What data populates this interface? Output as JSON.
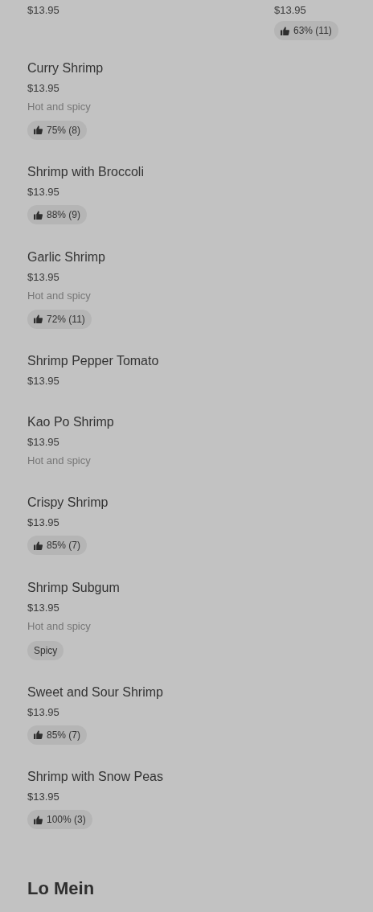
{
  "top_row": [
    {
      "price": "$13.95"
    },
    {
      "price": "$13.95",
      "rating": "63% (11)"
    }
  ],
  "items": [
    {
      "name": "Curry Shrimp",
      "price": "$13.95",
      "description": "Hot and spicy",
      "rating": "75% (8)"
    },
    {
      "name": "Shrimp with Broccoli",
      "price": "$13.95",
      "rating": "88% (9)"
    },
    {
      "name": "Garlic Shrimp",
      "price": "$13.95",
      "description": "Hot and spicy",
      "rating": "72% (11)"
    },
    {
      "name": "Shrimp Pepper Tomato",
      "price": "$13.95"
    },
    {
      "name": "Kao Po Shrimp",
      "price": "$13.95",
      "description": "Hot and spicy"
    },
    {
      "name": "Crispy Shrimp",
      "price": "$13.95",
      "rating": "85% (7)"
    },
    {
      "name": "Shrimp Subgum",
      "price": "$13.95",
      "description": "Hot and spicy",
      "tag": "Spicy"
    },
    {
      "name": "Sweet and Sour Shrimp",
      "price": "$13.95",
      "rating": "85% (7)"
    },
    {
      "name": "Shrimp with Snow Peas",
      "price": "$13.95",
      "rating": "100% (3)"
    }
  ],
  "next_section": {
    "title": "Lo Mein"
  }
}
